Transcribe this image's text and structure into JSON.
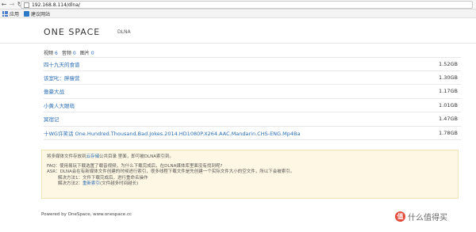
{
  "browser": {
    "url": "192.168.8.114/dlna/",
    "bookmarks": [
      "应用",
      "建议网站"
    ]
  },
  "header": {
    "brand": "ONE SPACE",
    "subtitle": "DLNA"
  },
  "counts": [
    {
      "label": "视频",
      "value": "6"
    },
    {
      "label": "音频",
      "value": "0"
    },
    {
      "label": "图片",
      "value": "0"
    }
  ],
  "files": [
    {
      "name": "四十九天的食谱",
      "size": "1.52GB"
    },
    {
      "name": "该室叱：胖瘦营",
      "size": "1.30GB"
    },
    {
      "name": "傲豪大战",
      "size": "1.17GB"
    },
    {
      "name": "小黄人大眼萌",
      "size": "1.01GB"
    },
    {
      "name": "冥宿记",
      "size": "1.47GB"
    },
    {
      "name": "十WG许笑话 One.Hundred.Thousand.Bad.Jokes.2014.HD1080P.X264.AAC.Mandarin.CHS-ENG.Mp4Ba",
      "size": "1.78GB"
    }
  ],
  "notice": {
    "line1_pre": "将多媒体文件存放到",
    "line1_link": "云存储",
    "line1_post": "公共目录 里面，即可被DLNA索引到。",
    "faq_q": "FAQ：使用易玩下载选置了载音视频，为什么下载完成后，在DLNA媒体库里面没有找到呢?",
    "faq_a": "ASR：DLNA会在有新媒体文件创建的时候进行索引，很多线程下载文件是先创建一个实际文件大小的空文件，所以下会被索引。",
    "sol1": "解决方法1：文件下载完成后，进行重命名操作",
    "sol2_pre": "解决方法2：",
    "sol2_link": "重新索引",
    "sol2_post": "(文件越多时间越长)"
  },
  "footer": {
    "text": "Powered by OneSpace, www.onespace.cc"
  },
  "watermark": {
    "badge": "值",
    "text": "什么值得买"
  }
}
